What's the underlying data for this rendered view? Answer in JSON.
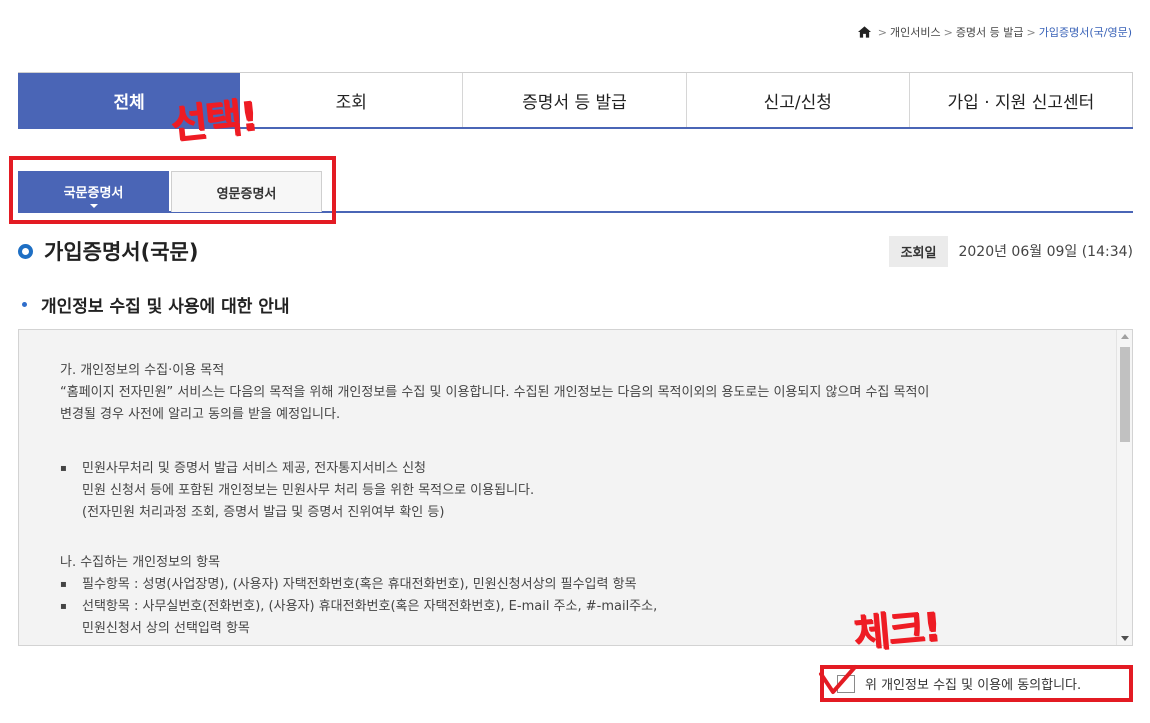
{
  "breadcrumb": {
    "home_icon": "home-icon",
    "items": [
      "개인서비스",
      "증명서 등 발급",
      "가입증명서(국/영문)"
    ]
  },
  "main_tabs": [
    {
      "label": "전체",
      "active": true
    },
    {
      "label": "조회",
      "active": false
    },
    {
      "label": "증명서 등 발급",
      "active": false
    },
    {
      "label": "신고/신청",
      "active": false
    },
    {
      "label": "가입 · 지원 신고센터",
      "active": false
    }
  ],
  "sub_tabs": [
    {
      "label": "국문증명서",
      "active": true
    },
    {
      "label": "영문증명서",
      "active": false
    }
  ],
  "annotations": {
    "select": "선택!",
    "check": "체크!"
  },
  "page": {
    "title": "가입증명서(국문)",
    "date_label": "조회일",
    "date_value": "2020년 06월 09일 (14:34)"
  },
  "section": {
    "title": "개인정보 수집 및 사용에 대한 안내"
  },
  "privacy": {
    "heading1": "가. 개인정보의 수집·이용 목적",
    "para1_line1": "“홈페이지 전자민원” 서비스는 다음의 목적을 위해 개인정보를 수집 및 이용합니다. 수집된 개인정보는 다음의 목적이외의 용도로는 이용되지 않으며 수집 목적이",
    "para1_line2": "변경될 경우 사전에 알리고 동의를 받을 예정입니다.",
    "bullet_symbol": "▪",
    "bullet1_line1": "민원사무처리 및 증명서 발급 서비스 제공, 전자통지서비스 신청",
    "bullet1_line2": "민원 신청서 등에 포함된 개인정보는 민원사무 처리 등을 위한 목적으로 이용됩니다.",
    "bullet1_line3": "(전자민원 처리과정 조회, 증명서 발급 및 증명서 진위여부 확인 등)",
    "heading2": "나. 수집하는 개인정보의 항목",
    "bullet2": "필수항목 : 성명(사업장명), (사용자) 자택전화번호(혹은 휴대전화번호), 민원신청서상의 필수입력 항목",
    "bullet3_line1": "선택항목 : 사무실번호(전화번호), (사용자) 휴대전화번호(혹은 자택전화번호), E-mail 주소, #-mail주소,",
    "bullet3_line2": "민원신청서 상의 선택입력 항목"
  },
  "agree": {
    "label": "위 개인정보 수집 및 이용에 동의합니다.",
    "checked": false
  },
  "colors": {
    "primary": "#4a65b6",
    "annotation_red": "#e31b23",
    "title_bullet": "#1e6fc4"
  }
}
